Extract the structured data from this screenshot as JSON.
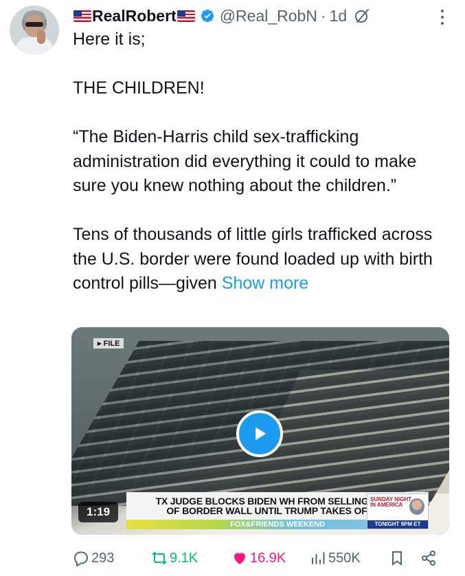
{
  "author": {
    "display_name": "RealRobert",
    "handle": "@Real_RobN",
    "timestamp": "1d",
    "verified": true
  },
  "tweet": {
    "paragraphs": [
      "Here it is;",
      "",
      "THE CHILDREN!",
      "",
      "“The Biden-Harris child sex-trafficking administration did everything it could to make sure you knew nothing about the children.”",
      "",
      "Tens of thousands of little girls trafficked across the U.S. border were found loaded up with birth control pills—given"
    ],
    "show_more": "Show more"
  },
  "media": {
    "file_tag": "FILE",
    "headline_line1": "TX JUDGE BLOCKS BIDEN WH FROM SELLING MORE",
    "headline_line2": "OF BORDER WALL UNTIL TRUMP TAKES OFFICE",
    "ticker": "FOX&FRIENDS WEEKEND",
    "promo_line1": "SUNDAY NIGHT",
    "promo_line2": "IN AMERICA",
    "promo_tonight": "TONIGHT 9PM ET",
    "duration": "1:19"
  },
  "actions": {
    "replies": "293",
    "reposts": "9.1K",
    "likes": "16.9K",
    "views": "550K"
  },
  "colors": {
    "accent": "#1d9bf0",
    "repost_active": "#00ba7c",
    "like_active": "#f91880",
    "muted": "#536471"
  }
}
